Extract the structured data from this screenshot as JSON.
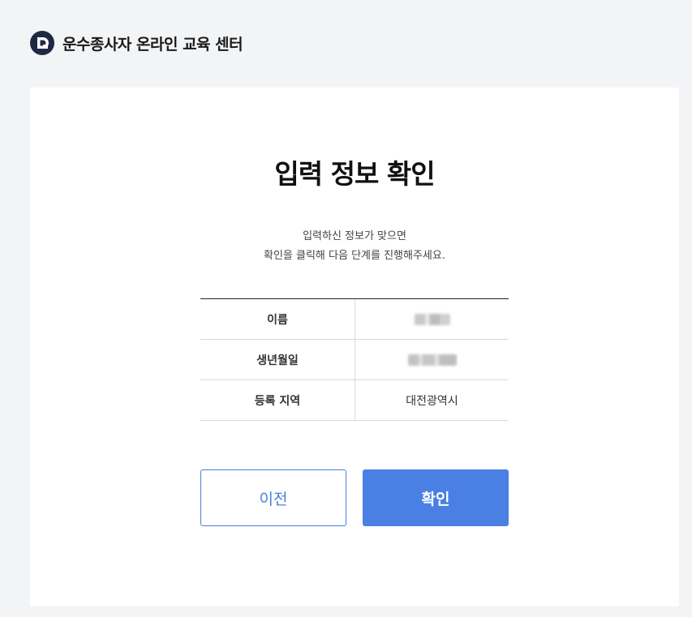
{
  "header": {
    "site_title": "운수종사자 온라인 교육 센터",
    "logo_icon": "d-logo-icon"
  },
  "main": {
    "title": "입력 정보 확인",
    "description_line1": "입력하신 정보가 맞으면",
    "description_line2": "확인을 클릭해 다음 단계를 진행해주세요.",
    "rows": [
      {
        "label": "이름",
        "value": ""
      },
      {
        "label": "생년월일",
        "value": ""
      },
      {
        "label": "등록 지역",
        "value": "대전광역시"
      }
    ],
    "prev_label": "이전",
    "confirm_label": "확인"
  },
  "colors": {
    "accent": "#4a80e3",
    "logo_bg": "#1e2a44",
    "page_bg": "#f3f4f6"
  }
}
